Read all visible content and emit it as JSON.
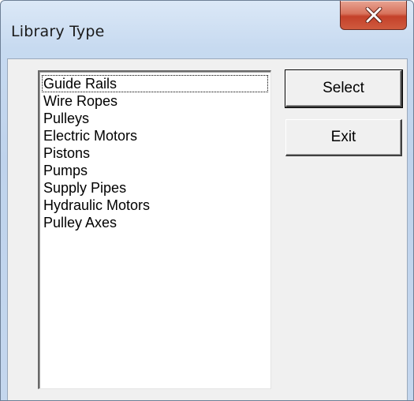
{
  "window": {
    "title": "Library Type",
    "close_icon": "close-x-icon"
  },
  "library_list": {
    "items": [
      "Guide Rails",
      "Wire Ropes",
      "Pulleys",
      "Electric Motors",
      "Pistons",
      "Pumps",
      "Supply Pipes",
      "Hydraulic Motors",
      "Pulley Axes"
    ],
    "focused_item": "Guide Rails"
  },
  "buttons": {
    "select_label": "Select",
    "exit_label": "Exit"
  },
  "colors": {
    "close_button": "#c4412a",
    "frame": "#c7daf0",
    "client_background": "#f0f0f0"
  }
}
